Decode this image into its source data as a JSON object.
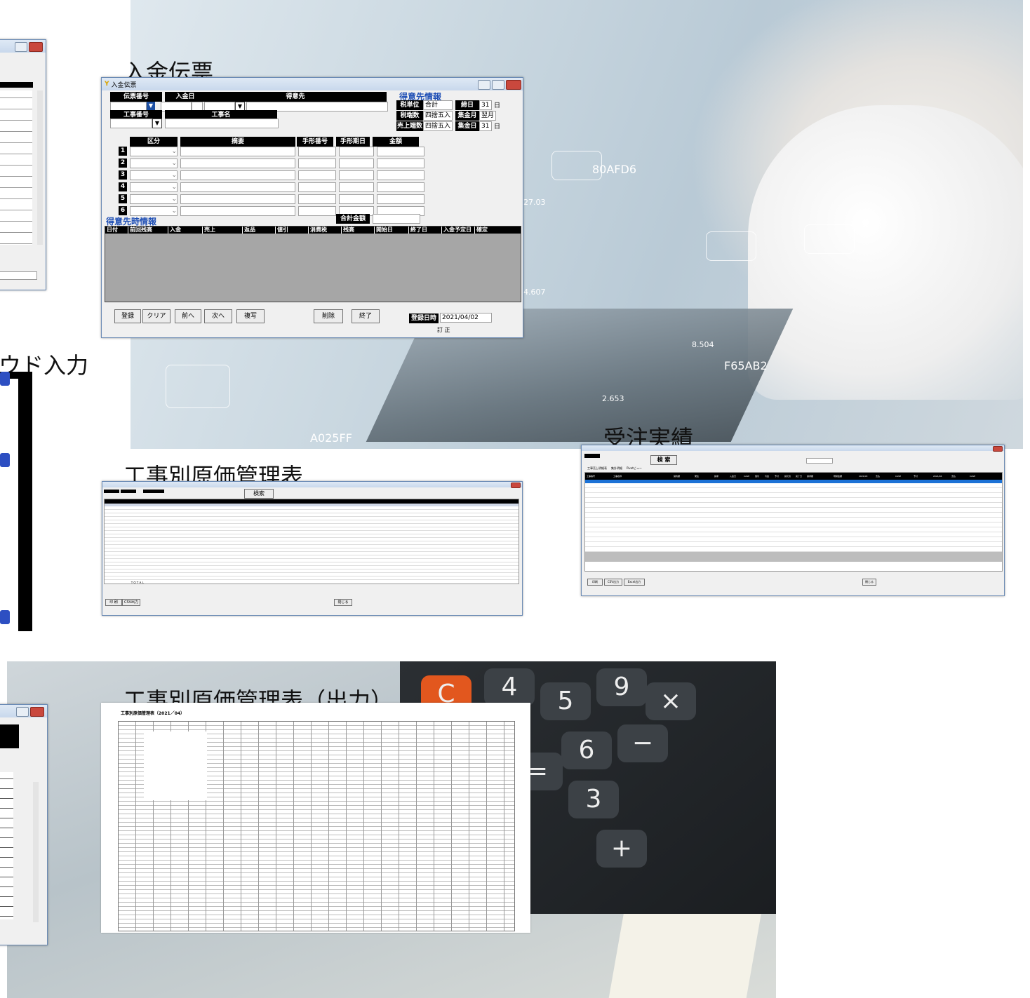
{
  "titles": {
    "nyukin": "入金伝票",
    "genka": "工事別原価管理表",
    "juchu": "受注実績",
    "genka_out": "工事別原価管理表（出力）",
    "window_input": "ウド入力"
  },
  "background_overlay_text": [
    "80AFD6",
    "A025FF",
    "F65AB2",
    "2.653",
    "27.03",
    "4.607",
    "8.504"
  ],
  "nyukin_window": {
    "title": "入金伝票",
    "header_labels": {
      "denpyo": "伝票番号",
      "nyukinbi": "入金日",
      "tokuisaki": "得意先",
      "koji_no": "工事番号",
      "koji_name": "工事名"
    },
    "tokuisaki_info": {
      "heading": "得意先情報",
      "rows": [
        {
          "label": "税単位",
          "value": "合計",
          "label2": "締日",
          "value2": "31",
          "unit": "日"
        },
        {
          "label": "税端数",
          "value": "四捨五入",
          "label2": "集金月",
          "value2": "翌月",
          "unit": ""
        },
        {
          "label": "売上端数",
          "value": "四捨五入",
          "label2": "集金日",
          "value2": "31",
          "unit": "日"
        }
      ]
    },
    "detail_headers": [
      "区分",
      "摘要",
      "手形番号",
      "手形期日",
      "金額"
    ],
    "row_numbers": [
      "1",
      "2",
      "3",
      "4",
      "5",
      "6"
    ],
    "total_label": "合計金額",
    "history_heading": "得意先時情報",
    "history_headers": [
      "日付",
      "前回残高",
      "入金",
      "売上",
      "返品",
      "値引",
      "消費税",
      "残高",
      "開始日",
      "終了日",
      "入金予定日",
      "確定"
    ],
    "buttons": [
      "登録",
      "クリア",
      "前へ",
      "次へ",
      "複写",
      "削除",
      "終了"
    ],
    "reg_date_label": "登録日時",
    "reg_date_value": "2021/04/02",
    "status_text": "訂 正"
  },
  "genka_window": {
    "search_button": "検索",
    "bottom_buttons": [
      "印 刷",
      "CSV出力",
      "閉じる"
    ],
    "summary_label": "ＴＯＴＡＬ"
  },
  "juchu_window": {
    "search_button": "検 索",
    "tabs": [
      "工事売上明細表",
      "集計明細",
      "Pivotビュー"
    ],
    "columns": [
      "工事番号",
      "工事名称",
      "契約額",
      "発注",
      "請求",
      "入金日",
      "CASH",
      "値引",
      "与金",
      "予付",
      "請元高",
      "完了日",
      "請求額",
      "現場金額",
      "2021/03",
      "支払",
      "CASH",
      "予付",
      "2021/04",
      "支払",
      "CASH"
    ],
    "bottom_buttons": [
      "印刷",
      "CSV出力",
      "Excel出力",
      "閉じる"
    ]
  },
  "genka_out_doc": {
    "heading": "工事別原価管理表（2021／04）"
  }
}
